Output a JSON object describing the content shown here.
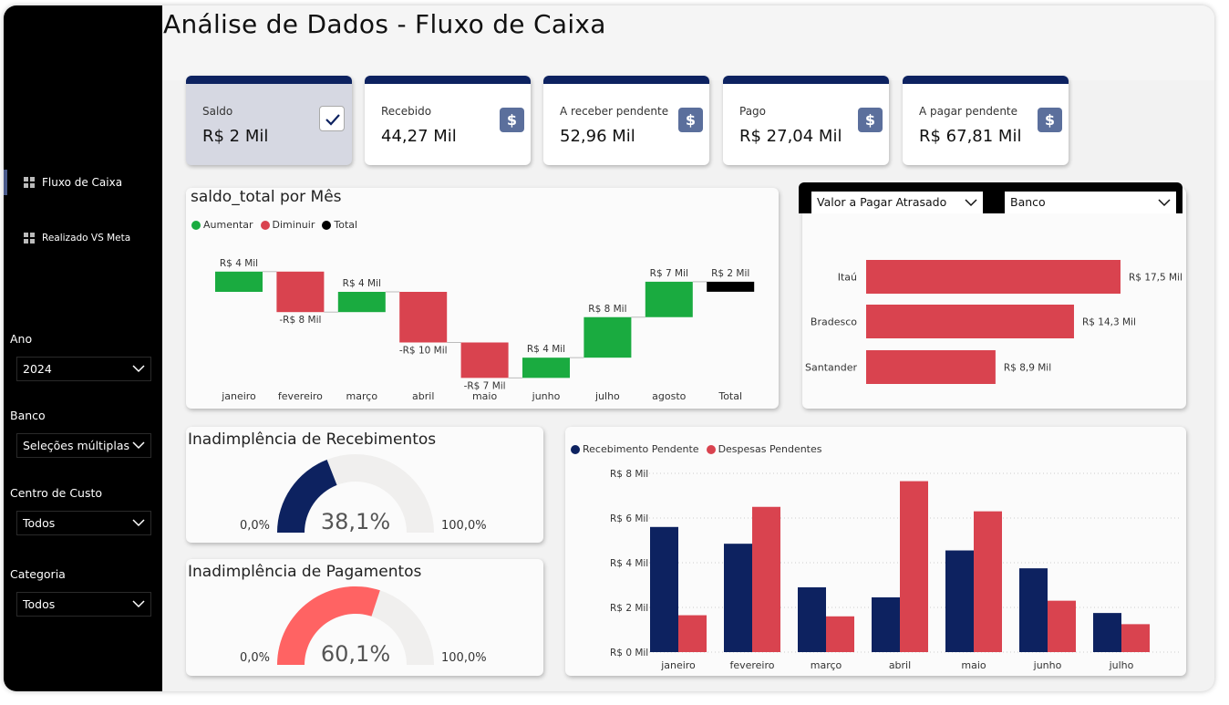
{
  "title": "Análise de Dados - Fluxo de Caixa",
  "nav": [
    {
      "label": "Fluxo de Caixa",
      "icon": "report-page-icon"
    },
    {
      "label": "Realizado VS Meta",
      "icon": "report-page-icon"
    }
  ],
  "filters": [
    {
      "label": "Ano",
      "value": "2024"
    },
    {
      "label": "Banco",
      "value": "Seleções múltiplas"
    },
    {
      "label": "Centro de Custo",
      "value": "Todos"
    },
    {
      "label": "Categoria",
      "value": "Todos"
    }
  ],
  "cards": [
    {
      "label": "Saldo",
      "value": "R$ 2 Mil",
      "icon": "check-icon",
      "selected": true
    },
    {
      "label": "Recebido",
      "value": "44,27 Mil",
      "icon": "dollar-icon"
    },
    {
      "label": "A receber pendente",
      "value": "52,96 Mil",
      "icon": "dollar-icon"
    },
    {
      "label": "Pago",
      "value": "R$ 27,04 Mil",
      "icon": "dollar-icon"
    },
    {
      "label": "A pagar pendente",
      "value": "R$ 67,81 Mil",
      "icon": "dollar-icon"
    }
  ],
  "colors": {
    "navy": "#0d2260",
    "increase": "#1aab40",
    "decrease": "#d9434f",
    "total": "#000000",
    "gauge_pay": "#ff6363",
    "gauge_bg": "#f0efee"
  },
  "dropdowns": {
    "left": "Valor a Pagar Atrasado",
    "right": "Banco"
  },
  "chart_data": [
    {
      "type": "waterfall",
      "title": "saldo_total por Mês",
      "legend": [
        "Aumentar",
        "Diminuir",
        "Total"
      ],
      "categories": [
        "janeiro",
        "fevereiro",
        "março",
        "abril",
        "maio",
        "junho",
        "julho",
        "agosto",
        "Total"
      ],
      "values": [
        4,
        -8,
        4,
        -10,
        -7,
        4,
        8,
        7,
        2
      ],
      "labels": [
        "R$ 4 Mil",
        "-R$ 8 Mil",
        "R$ 4 Mil",
        "-R$ 10 Mil",
        "-R$ 7 Mil",
        "R$ 4 Mil",
        "R$ 8 Mil",
        "R$ 7 Mil",
        "R$ 2 Mil"
      ]
    },
    {
      "type": "bar",
      "orientation": "horizontal",
      "categories": [
        "Itaú",
        "Bradesco",
        "Santander"
      ],
      "values": [
        17.5,
        14.3,
        8.9
      ],
      "labels": [
        "R$ 17,5 Mil",
        "R$ 14,3 Mil",
        "R$ 8,9 Mil"
      ]
    },
    {
      "type": "gauge",
      "title": "Inadimplência de Recebimentos",
      "value_label": "38,1%",
      "value": 38.1,
      "min_label": "0,0%",
      "max_label": "100,0%"
    },
    {
      "type": "gauge",
      "title": "Inadimplência de Pagamentos",
      "value_label": "60,1%",
      "value": 60.1,
      "min_label": "0,0%",
      "max_label": "100,0%"
    },
    {
      "type": "bar",
      "categories": [
        "janeiro",
        "fevereiro",
        "março",
        "abril",
        "maio",
        "junho",
        "julho"
      ],
      "series": [
        {
          "name": "Recebimento Pendente",
          "values": [
            5.6,
            4.85,
            2.9,
            2.45,
            4.55,
            3.75,
            1.75
          ]
        },
        {
          "name": "Despesas Pendentes",
          "values": [
            1.65,
            6.5,
            1.6,
            7.65,
            6.3,
            2.3,
            1.25
          ]
        }
      ],
      "yticks": [
        "R$ 0 Mil",
        "R$ 2 Mil",
        "R$ 4 Mil",
        "R$ 6 Mil",
        "R$ 8 Mil"
      ],
      "ylim": [
        0,
        8
      ]
    }
  ]
}
